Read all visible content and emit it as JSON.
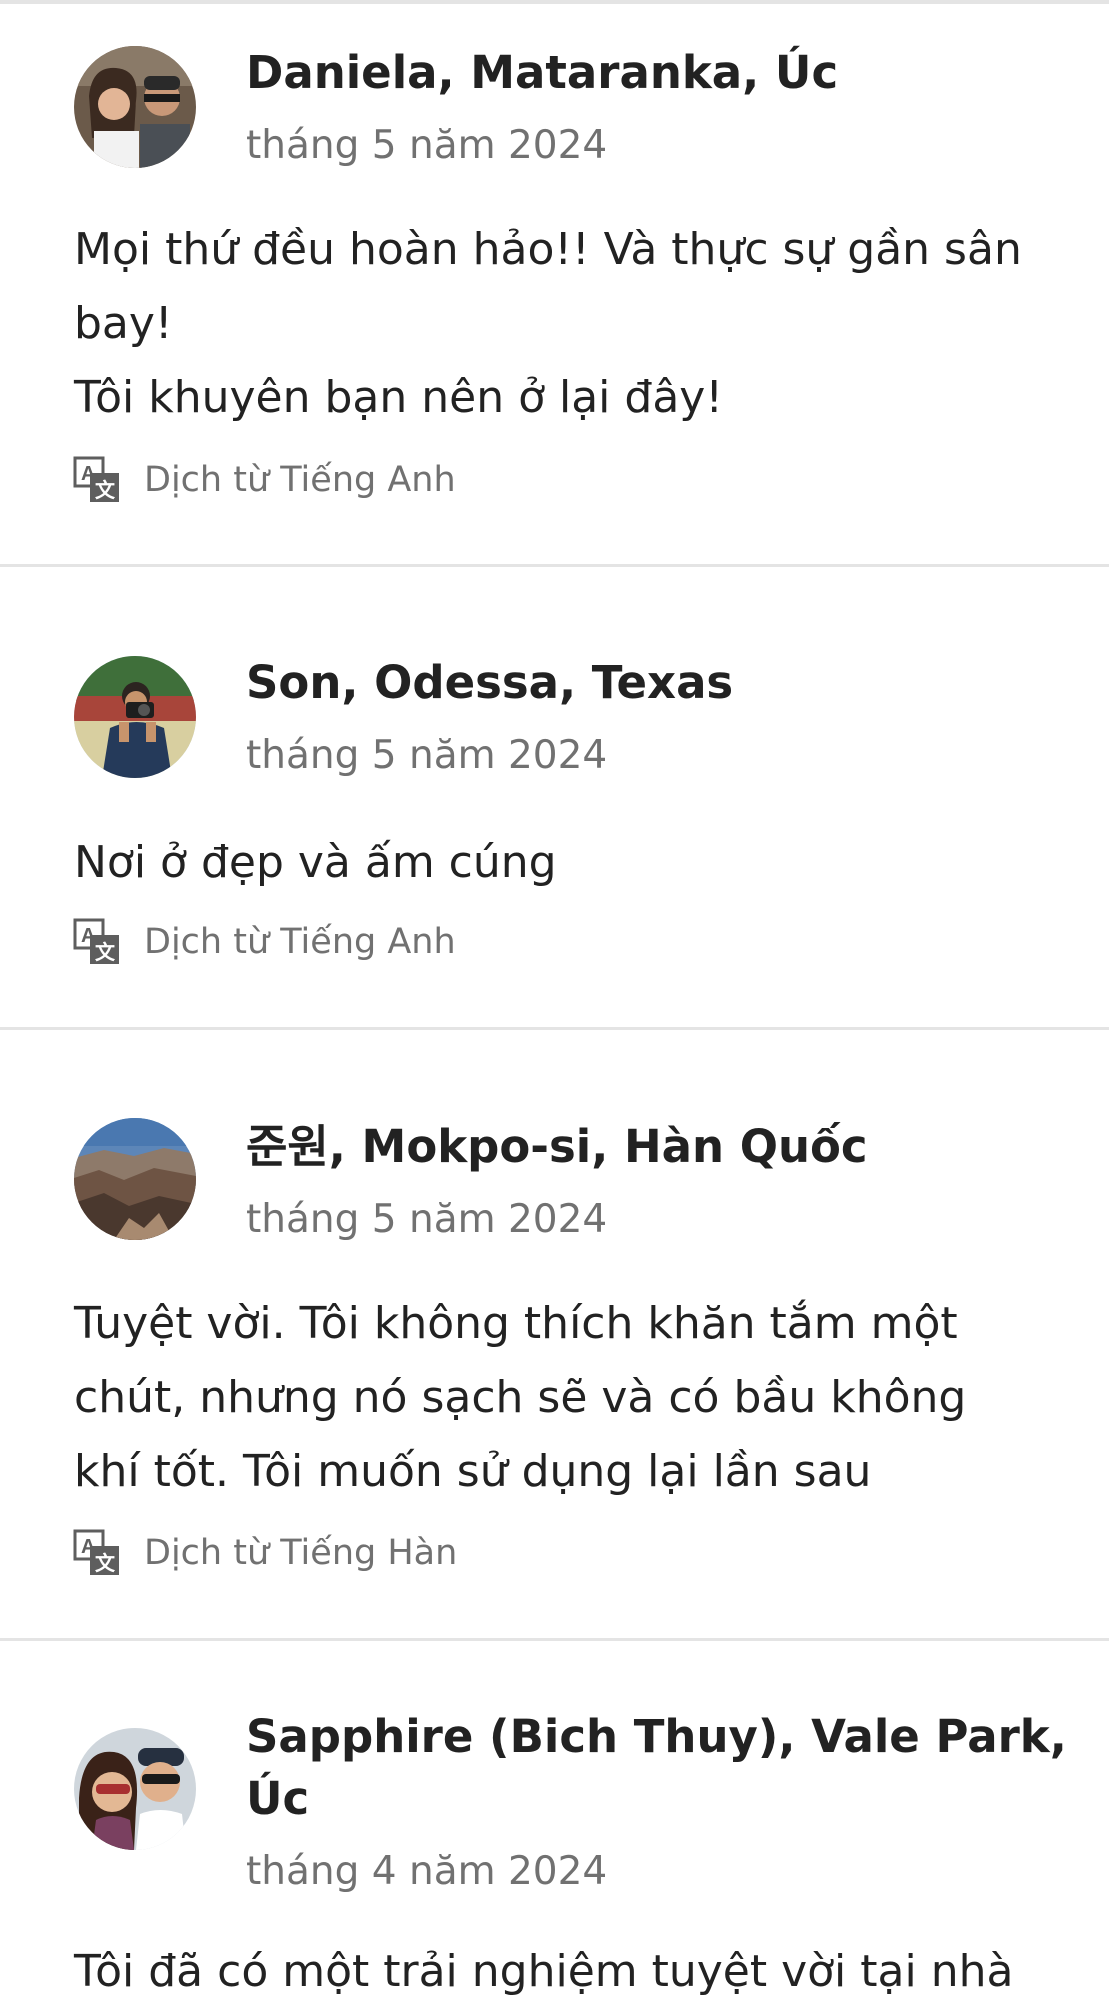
{
  "reviews": [
    {
      "name": "Daniela, Mataranka, Úc",
      "date": "tháng 5 năm 2024",
      "body": [
        "Mọi thứ đều hoàn hảo!! Và thực sự gần sân",
        "bay!",
        "Tôi khuyên bạn nên ở lại đây!"
      ],
      "translation": "Dịch từ Tiếng Anh",
      "avatar_icon": "couple-photo-avatar"
    },
    {
      "name": "Son, Odessa, Texas",
      "date": "tháng 5 năm 2024",
      "body": [
        "Nơi ở đẹp và ấm cúng"
      ],
      "translation": "Dịch từ Tiếng Anh",
      "avatar_icon": "photographer-avatar"
    },
    {
      "name": "준원, Mokpo-si, Hàn Quốc",
      "date": "tháng 5 năm 2024",
      "body": [
        "Tuyệt vời. Tôi không thích khăn tắm một",
        "chút, nhưng nó sạch sẽ và có bầu không",
        "khí tốt. Tôi muốn sử dụng lại lần sau"
      ],
      "translation": "Dịch từ Tiếng Hàn",
      "avatar_icon": "canyon-landscape-avatar"
    },
    {
      "name_lines": [
        "Sapphire (Bich Thuy), Vale Park,",
        "Úc"
      ],
      "date": "tháng 4 năm 2024",
      "body": [
        "Tôi đã có một trải nghiệm tuyệt vời tại nhà"
      ],
      "avatar_icon": "couple-selfie-avatar"
    }
  ],
  "colors": {
    "text_primary": "#222222",
    "text_secondary": "#717171",
    "divider": "#e4e4e4"
  }
}
